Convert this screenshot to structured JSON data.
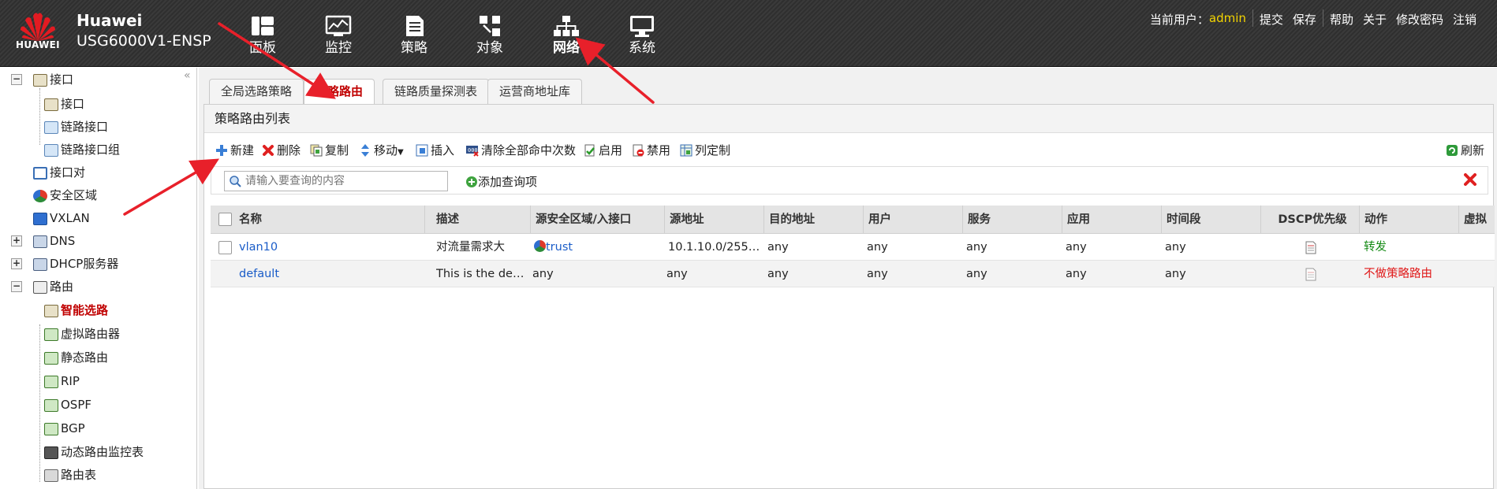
{
  "header": {
    "logo_text": "HUAWEI",
    "brand_name": "Huawei",
    "device_model": "USG6000V1-ENSP",
    "nav_tabs": [
      {
        "label": "面板",
        "icon": "dashboard-icon"
      },
      {
        "label": "监控",
        "icon": "monitor-icon"
      },
      {
        "label": "策略",
        "icon": "policy-icon"
      },
      {
        "label": "对象",
        "icon": "object-icon"
      },
      {
        "label": "网络",
        "icon": "network-icon",
        "active": true
      },
      {
        "label": "系统",
        "icon": "system-icon"
      }
    ],
    "current_user_label": "当前用户：",
    "current_user": "admin",
    "actions": {
      "commit": "提交",
      "save": "保存",
      "help": "帮助",
      "about": "关于",
      "change_password": "修改密码",
      "logout": "注销"
    }
  },
  "sidebar": {
    "items": [
      {
        "label": "接口",
        "level": 0,
        "toggle": "−",
        "icon": "interface-icon"
      },
      {
        "label": "接口",
        "level": 1,
        "icon": "interface-icon"
      },
      {
        "label": "链路接口",
        "level": 1,
        "icon": "link-interface-icon"
      },
      {
        "label": "链路接口组",
        "level": 1,
        "icon": "link-group-icon"
      },
      {
        "label": "接口对",
        "level": 0,
        "icon": "interface-pair-icon"
      },
      {
        "label": "安全区域",
        "level": 0,
        "icon": "security-zone-icon"
      },
      {
        "label": "VXLAN",
        "level": 0,
        "icon": "vxlan-icon"
      },
      {
        "label": "DNS",
        "level": 0,
        "toggle": "+",
        "icon": "dns-icon"
      },
      {
        "label": "DHCP服务器",
        "level": 0,
        "toggle": "+",
        "icon": "dhcp-icon"
      },
      {
        "label": "路由",
        "level": 0,
        "toggle": "−",
        "icon": "route-icon"
      },
      {
        "label": "智能选路",
        "level": 1,
        "icon": "smart-route-icon",
        "selected": true
      },
      {
        "label": "虚拟路由器",
        "level": 1,
        "icon": "virtual-router-icon"
      },
      {
        "label": "静态路由",
        "level": 1,
        "icon": "static-route-icon"
      },
      {
        "label": "RIP",
        "level": 1,
        "icon": "rip-icon"
      },
      {
        "label": "OSPF",
        "level": 1,
        "icon": "ospf-icon"
      },
      {
        "label": "BGP",
        "level": 1,
        "icon": "bgp-icon"
      },
      {
        "label": "动态路由监控表",
        "level": 1,
        "icon": "route-monitor-icon"
      },
      {
        "label": "路由表",
        "level": 1,
        "icon": "route-table-icon"
      }
    ]
  },
  "content_tabs": [
    "全局选路策略",
    "策略路由",
    "链路质量探测表",
    "运营商地址库"
  ],
  "active_tab": "策略路由",
  "panel_title": "策略路由列表",
  "toolbar": {
    "new": "新建",
    "delete": "删除",
    "copy": "复制",
    "move": "移动",
    "insert": "插入",
    "clear_hits": "清除全部命中次数",
    "enable": "启用",
    "disable": "禁用",
    "customize_columns": "列定制",
    "refresh": "刷新"
  },
  "search": {
    "placeholder": "请输入要查询的内容",
    "add_query": "添加查询项"
  },
  "table": {
    "columns": [
      "名称",
      "描述",
      "源安全区域/入接口",
      "源地址",
      "目的地址",
      "用户",
      "服务",
      "应用",
      "时间段",
      "DSCP优先级",
      "动作",
      "虚拟"
    ],
    "rows": [
      {
        "name": "vlan10",
        "desc": "对流量需求大",
        "src_zone": "trust",
        "src_addr": "10.1.10.0/255.…",
        "dst_addr": "any",
        "user": "any",
        "service": "any",
        "app": "any",
        "time": "any",
        "action": "转发"
      },
      {
        "name": "default",
        "desc": "This is the def…",
        "src_zone": "any",
        "src_addr": "any",
        "dst_addr": "any",
        "user": "any",
        "service": "any",
        "app": "any",
        "time": "any",
        "action": "不做策略路由"
      }
    ]
  },
  "colors": {
    "accent_red": "#c00000",
    "link_blue": "#1a5cc8",
    "forward_green": "#138a13",
    "noroute_red": "#e01818",
    "user_yellow": "#f3d400"
  }
}
